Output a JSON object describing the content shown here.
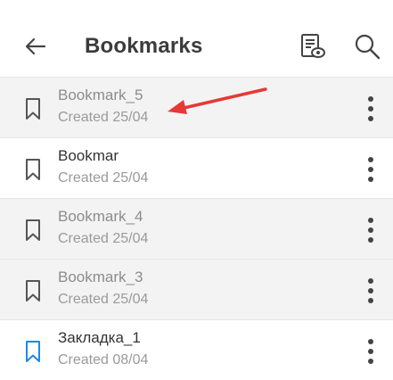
{
  "header": {
    "title": "Bookmarks",
    "back_icon": "arrow-left-icon",
    "view_icon": "document-view-icon",
    "search_icon": "search-icon"
  },
  "bookmarks": [
    {
      "name": "Bookmark_5",
      "date": "Created 25/04",
      "state": "dim",
      "icon_color": "#555555"
    },
    {
      "name": "Bookmar",
      "date": "Created 25/04",
      "state": "plain",
      "icon_color": "#555555"
    },
    {
      "name": "Bookmark_4",
      "date": "Created 25/04",
      "state": "dim",
      "icon_color": "#555555"
    },
    {
      "name": "Bookmark_3",
      "date": "Created 25/04",
      "state": "dim",
      "icon_color": "#555555"
    },
    {
      "name": "Закладка_1",
      "date": "Created 08/04",
      "state": "plain",
      "icon_color": "#1e88e5"
    }
  ],
  "annotation": {
    "arrow_color": "#e53935",
    "points_to": "Bookmark_5"
  }
}
